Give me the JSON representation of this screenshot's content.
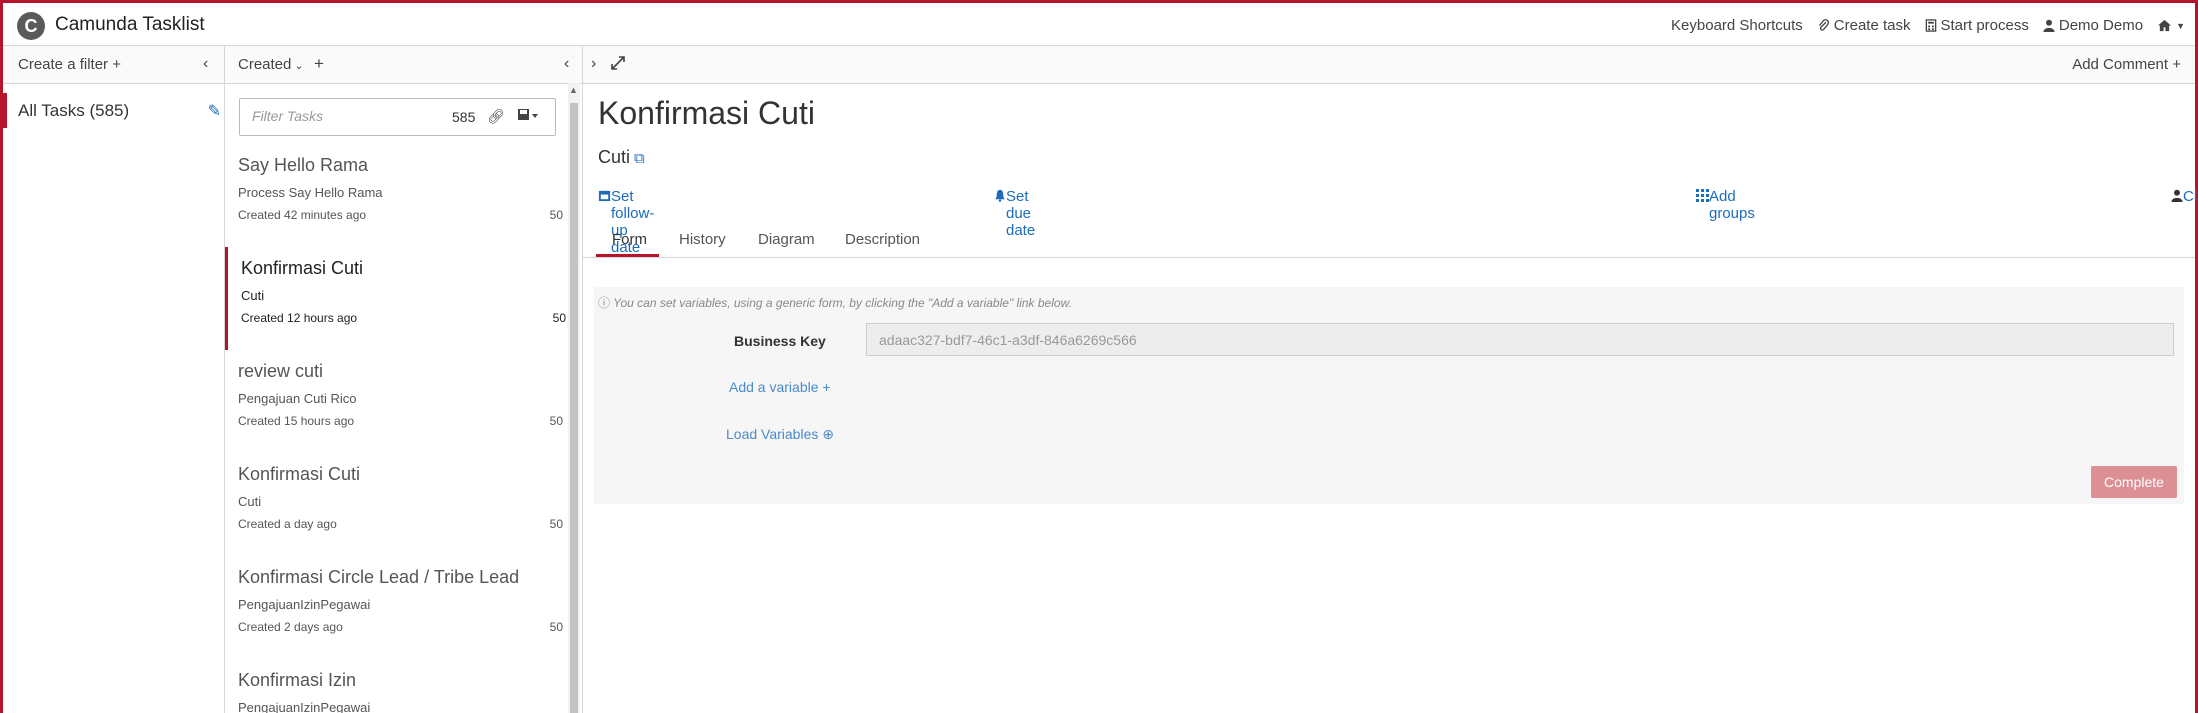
{
  "header": {
    "app_title": "Camunda Tasklist",
    "logo_glyph": "C",
    "keyboard_shortcuts": "Keyboard Shortcuts",
    "create_task": "Create task",
    "start_process": "Start process",
    "user": "Demo Demo"
  },
  "filters": {
    "create_filter": "Create a filter",
    "items": [
      {
        "label": "All Tasks (585)"
      }
    ]
  },
  "list": {
    "sort_label": "Created",
    "search_placeholder": "Filter Tasks",
    "count": "585",
    "tasks": [
      {
        "name": "Say Hello Rama",
        "process": "Process Say Hello Rama",
        "created": "Created 42 minutes ago",
        "priority": "50"
      },
      {
        "name": "Konfirmasi Cuti",
        "process": "Cuti",
        "created": "Created 12 hours ago",
        "priority": "50"
      },
      {
        "name": "review cuti",
        "process": "Pengajuan Cuti Rico",
        "created": "Created 15 hours ago",
        "priority": "50"
      },
      {
        "name": "Konfirmasi Cuti",
        "process": "Cuti",
        "created": "Created a day ago",
        "priority": "50"
      },
      {
        "name": "Konfirmasi Circle Lead / Tribe Lead",
        "process": "PengajuanIzinPegawai",
        "created": "Created 2 days ago",
        "priority": "50"
      },
      {
        "name": "Konfirmasi Izin",
        "process": "PengajuanIzinPegawai",
        "created": "",
        "priority": ""
      }
    ]
  },
  "task": {
    "add_comment": "Add Comment",
    "title": "Konfirmasi Cuti",
    "process": "Cuti",
    "set_followup": "Set follow-up date",
    "set_due": "Set due date",
    "add_groups": "Add groups",
    "claim": "Claim",
    "tabs": [
      {
        "label": "Form"
      },
      {
        "label": "History"
      },
      {
        "label": "Diagram"
      },
      {
        "label": "Description"
      }
    ],
    "form": {
      "hint": "You can set variables, using a generic form, by clicking the \"Add a variable\" link below.",
      "business_key_label": "Business Key",
      "business_key_value": "adaac327-bdf7-46c1-a3df-846a6269c566",
      "add_variable": "Add a variable",
      "load_variables": "Load Variables",
      "complete": "Complete"
    }
  },
  "colors": {
    "accent": "#b5152b",
    "link": "#1c6dbc",
    "complete_button": "#dc8f95"
  }
}
